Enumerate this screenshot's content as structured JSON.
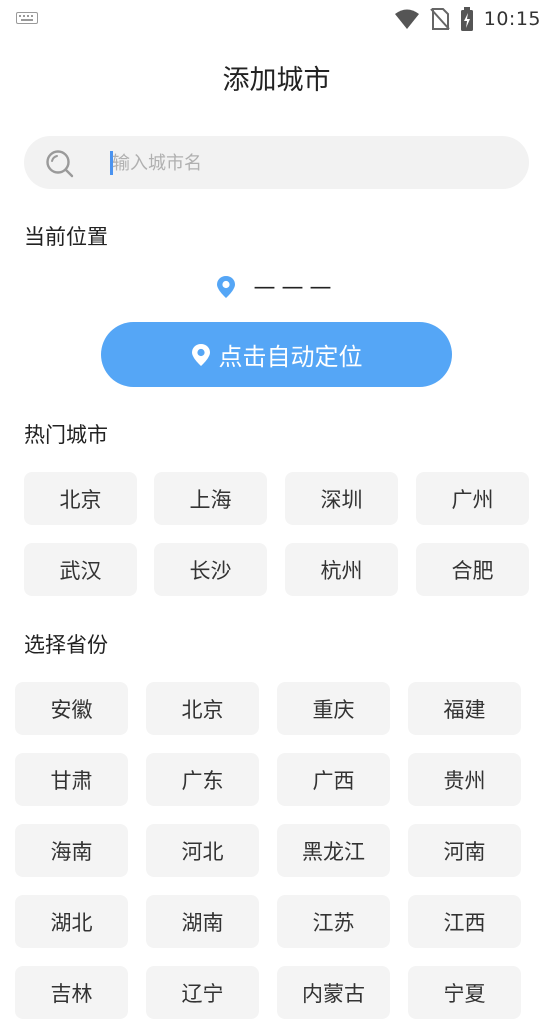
{
  "status_bar": {
    "time": "10:15"
  },
  "title": "添加城市",
  "search": {
    "placeholder": "输入城市名"
  },
  "current_location": {
    "label": "当前位置",
    "value": "———"
  },
  "locate_button": {
    "label": "点击自动定位"
  },
  "hot_cities": {
    "label": "热门城市",
    "items": [
      "北京",
      "上海",
      "深圳",
      "广州",
      "武汉",
      "长沙",
      "杭州",
      "合肥"
    ]
  },
  "provinces": {
    "label": "选择省份",
    "items": [
      "安徽",
      "北京",
      "重庆",
      "福建",
      "甘肃",
      "广东",
      "广西",
      "贵州",
      "海南",
      "河北",
      "黑龙江",
      "河南",
      "湖北",
      "湖南",
      "江苏",
      "江西",
      "吉林",
      "辽宁",
      "内蒙古",
      "宁夏"
    ]
  },
  "colors": {
    "accent": "#55a6f6",
    "chip_bg": "#f4f4f4",
    "search_bg": "#f2f2f2"
  }
}
